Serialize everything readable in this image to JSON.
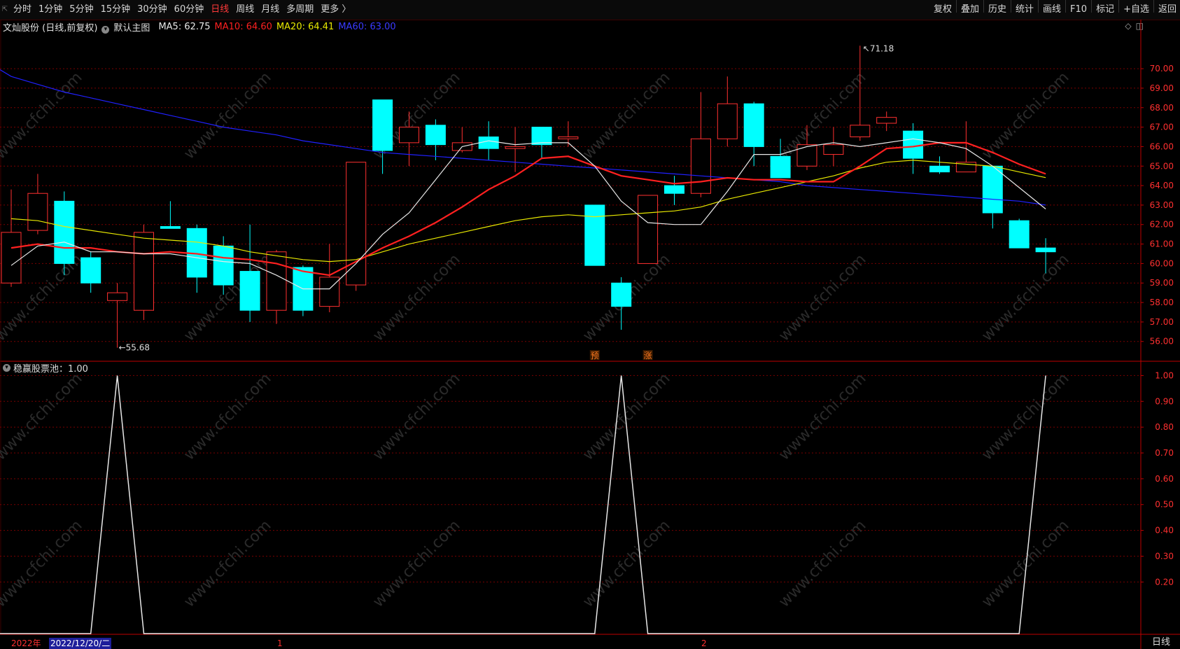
{
  "toolbar": {
    "periods": [
      {
        "label": "分时",
        "active": false
      },
      {
        "label": "1分钟",
        "active": false
      },
      {
        "label": "5分钟",
        "active": false
      },
      {
        "label": "15分钟",
        "active": false
      },
      {
        "label": "30分钟",
        "active": false
      },
      {
        "label": "60分钟",
        "active": false
      },
      {
        "label": "日线",
        "active": true
      },
      {
        "label": "周线",
        "active": false
      },
      {
        "label": "月线",
        "active": false
      },
      {
        "label": "多周期",
        "active": false
      },
      {
        "label": "更多 〉",
        "active": false
      }
    ],
    "tools": [
      "复权",
      "叠加",
      "历史",
      "统计",
      "画线",
      "F10",
      "标记",
      "+自选",
      "返回"
    ]
  },
  "main_chart": {
    "stock_name": "文灿股份 (日线,前复权)",
    "template_label": "默认主图",
    "ma5_label": "MA5: 62.75",
    "ma10_label": "MA10: 64.60",
    "ma20_label": "MA20: 64.41",
    "ma60_label": "MA60: 63.00",
    "high_marker": "71.18",
    "low_marker": "55.68",
    "signal_1": "预",
    "signal_2": "涨"
  },
  "sub_chart": {
    "indicator_label": "稳赢股票池：1.00"
  },
  "bottom": {
    "year_label": "2022年",
    "date_label": "2022/12/20/二",
    "month_1": "1",
    "month_2": "2",
    "period_label": "日线"
  },
  "colors": {
    "up": "#ff3030",
    "down": "#00ffff",
    "ma5": "#e8e8e8",
    "ma10": "#ff2020",
    "ma20": "#e8e800",
    "ma60": "#2020ff",
    "grid": "#7a0000",
    "axis": "#c00000"
  },
  "chart_data": [
    {
      "type": "candlestick",
      "price_axis": [
        56,
        57,
        58,
        59,
        60,
        61,
        62,
        63,
        64,
        65,
        66,
        67,
        68,
        69,
        70
      ],
      "price_range": [
        55.2,
        71.8
      ],
      "candles": [
        {
          "open": 59.0,
          "high": 63.8,
          "low": 58.8,
          "close": 61.6
        },
        {
          "open": 61.7,
          "high": 64.6,
          "low": 61.5,
          "close": 63.6
        },
        {
          "open": 63.2,
          "high": 63.7,
          "low": 59.4,
          "close": 60.0
        },
        {
          "open": 60.3,
          "high": 60.6,
          "low": 58.5,
          "close": 59.0
        },
        {
          "open": 58.1,
          "high": 59.0,
          "low": 55.68,
          "close": 58.5
        },
        {
          "open": 57.6,
          "high": 62.0,
          "low": 57.1,
          "close": 61.6
        },
        {
          "open": 61.9,
          "high": 63.2,
          "low": 61.8,
          "close": 61.8
        },
        {
          "open": 61.8,
          "high": 62.0,
          "low": 58.5,
          "close": 59.3
        },
        {
          "open": 60.9,
          "high": 61.4,
          "low": 58.4,
          "close": 58.9
        },
        {
          "open": 59.6,
          "high": 62.0,
          "low": 57.0,
          "close": 57.6
        },
        {
          "open": 57.6,
          "high": 60.7,
          "low": 56.9,
          "close": 60.6
        },
        {
          "open": 59.8,
          "high": 59.9,
          "low": 57.3,
          "close": 57.6
        },
        {
          "open": 57.8,
          "high": 61.0,
          "low": 57.5,
          "close": 59.3
        },
        {
          "open": 58.9,
          "high": 65.2,
          "low": 58.6,
          "close": 65.2
        },
        {
          "open": 68.4,
          "high": 68.4,
          "low": 64.6,
          "close": 65.8
        },
        {
          "open": 66.2,
          "high": 67.8,
          "low": 65.0,
          "close": 67.0
        },
        {
          "open": 67.1,
          "high": 67.4,
          "low": 65.3,
          "close": 66.1
        },
        {
          "open": 65.8,
          "high": 67.0,
          "low": 65.7,
          "close": 66.2
        },
        {
          "open": 66.5,
          "high": 67.3,
          "low": 65.3,
          "close": 65.9
        },
        {
          "open": 65.9,
          "high": 67.0,
          "low": 64.7,
          "close": 66.0
        },
        {
          "open": 67.0,
          "high": 67.0,
          "low": 65.4,
          "close": 66.1
        },
        {
          "open": 66.4,
          "high": 67.3,
          "low": 66.0,
          "close": 66.5
        },
        {
          "open": 63.0,
          "high": 63.0,
          "low": 59.9,
          "close": 59.9
        },
        {
          "open": 59.0,
          "high": 59.3,
          "low": 56.6,
          "close": 57.8
        },
        {
          "open": 60.0,
          "high": 63.5,
          "low": 60.0,
          "close": 63.5
        },
        {
          "open": 64.0,
          "high": 64.5,
          "low": 63.0,
          "close": 63.6
        },
        {
          "open": 63.6,
          "high": 68.8,
          "low": 63.4,
          "close": 66.4
        },
        {
          "open": 66.4,
          "high": 69.6,
          "low": 66.0,
          "close": 68.2
        },
        {
          "open": 68.2,
          "high": 68.3,
          "low": 65.0,
          "close": 66.0
        },
        {
          "open": 65.5,
          "high": 66.4,
          "low": 64.4,
          "close": 64.4
        },
        {
          "open": 65.0,
          "high": 67.1,
          "low": 64.8,
          "close": 66.1
        },
        {
          "open": 65.6,
          "high": 67.0,
          "low": 65.0,
          "close": 66.1
        },
        {
          "open": 66.5,
          "high": 71.18,
          "low": 66.3,
          "close": 67.1
        },
        {
          "open": 67.2,
          "high": 67.8,
          "low": 66.8,
          "close": 67.5
        },
        {
          "open": 66.8,
          "high": 67.2,
          "low": 64.6,
          "close": 65.4
        },
        {
          "open": 65.0,
          "high": 65.5,
          "low": 64.6,
          "close": 64.7
        },
        {
          "open": 64.7,
          "high": 67.3,
          "low": 64.7,
          "close": 65.2
        },
        {
          "open": 65.0,
          "high": 65.0,
          "low": 61.8,
          "close": 62.6
        },
        {
          "open": 62.2,
          "high": 62.3,
          "low": 60.8,
          "close": 60.8
        },
        {
          "open": 60.8,
          "high": 61.3,
          "low": 59.5,
          "close": 60.6
        }
      ],
      "ma5": [
        59.9,
        60.9,
        61.1,
        60.6,
        60.6,
        60.5,
        60.5,
        60.3,
        60.1,
        60.0,
        59.4,
        58.7,
        58.7,
        60.0,
        61.5,
        62.6,
        64.3,
        66.0,
        66.3,
        66.1,
        66.2,
        66.2,
        65.0,
        63.2,
        62.1,
        62.0,
        62.0,
        63.7,
        65.6,
        65.6,
        66.0,
        66.2,
        66.0,
        66.2,
        66.4,
        66.2,
        65.9,
        65.0,
        63.9,
        62.8
      ],
      "ma10": [
        60.8,
        61.0,
        60.8,
        60.8,
        60.6,
        60.5,
        60.6,
        60.5,
        60.3,
        60.2,
        60.0,
        59.6,
        59.4,
        60.1,
        60.8,
        61.4,
        62.1,
        62.9,
        63.8,
        64.5,
        65.4,
        65.5,
        65.0,
        64.5,
        64.3,
        64.1,
        64.2,
        64.4,
        64.3,
        64.3,
        64.2,
        64.2,
        65.0,
        65.9,
        66.0,
        66.2,
        66.2,
        65.7,
        65.1,
        64.6
      ],
      "ma20": [
        62.3,
        62.2,
        61.9,
        61.7,
        61.5,
        61.3,
        61.2,
        61.1,
        60.9,
        60.6,
        60.4,
        60.2,
        60.1,
        60.2,
        60.6,
        61.0,
        61.3,
        61.6,
        61.9,
        62.2,
        62.4,
        62.5,
        62.4,
        62.5,
        62.6,
        62.7,
        62.9,
        63.3,
        63.6,
        63.9,
        64.2,
        64.5,
        64.9,
        65.2,
        65.3,
        65.2,
        65.1,
        65.0,
        64.7,
        64.41
      ],
      "ma60": [
        69.6,
        69.2,
        68.8,
        68.5,
        68.2,
        67.9,
        67.6,
        67.3,
        67.0,
        66.8,
        66.6,
        66.3,
        66.1,
        65.9,
        65.7,
        65.6,
        65.5,
        65.4,
        65.3,
        65.2,
        65.1,
        65.0,
        64.9,
        64.8,
        64.7,
        64.6,
        64.5,
        64.4,
        64.3,
        64.2,
        64.0,
        63.9,
        63.8,
        63.7,
        63.6,
        63.5,
        63.4,
        63.3,
        63.2,
        63.0
      ]
    },
    {
      "type": "line",
      "title": "稳赢股票池",
      "y_axis": [
        0.2,
        0.3,
        0.4,
        0.5,
        0.6,
        0.7,
        0.8,
        0.9,
        1.0
      ],
      "y_range": [
        0,
        1.05
      ],
      "values": [
        0,
        0,
        0,
        0,
        1,
        0,
        0,
        0,
        0,
        0,
        0,
        0,
        0,
        0,
        0,
        0,
        0,
        0,
        0,
        0,
        0,
        0,
        0,
        1,
        0,
        0,
        0,
        0,
        0,
        0,
        0,
        0,
        0,
        0,
        0,
        0,
        0,
        0,
        0,
        1
      ]
    }
  ]
}
